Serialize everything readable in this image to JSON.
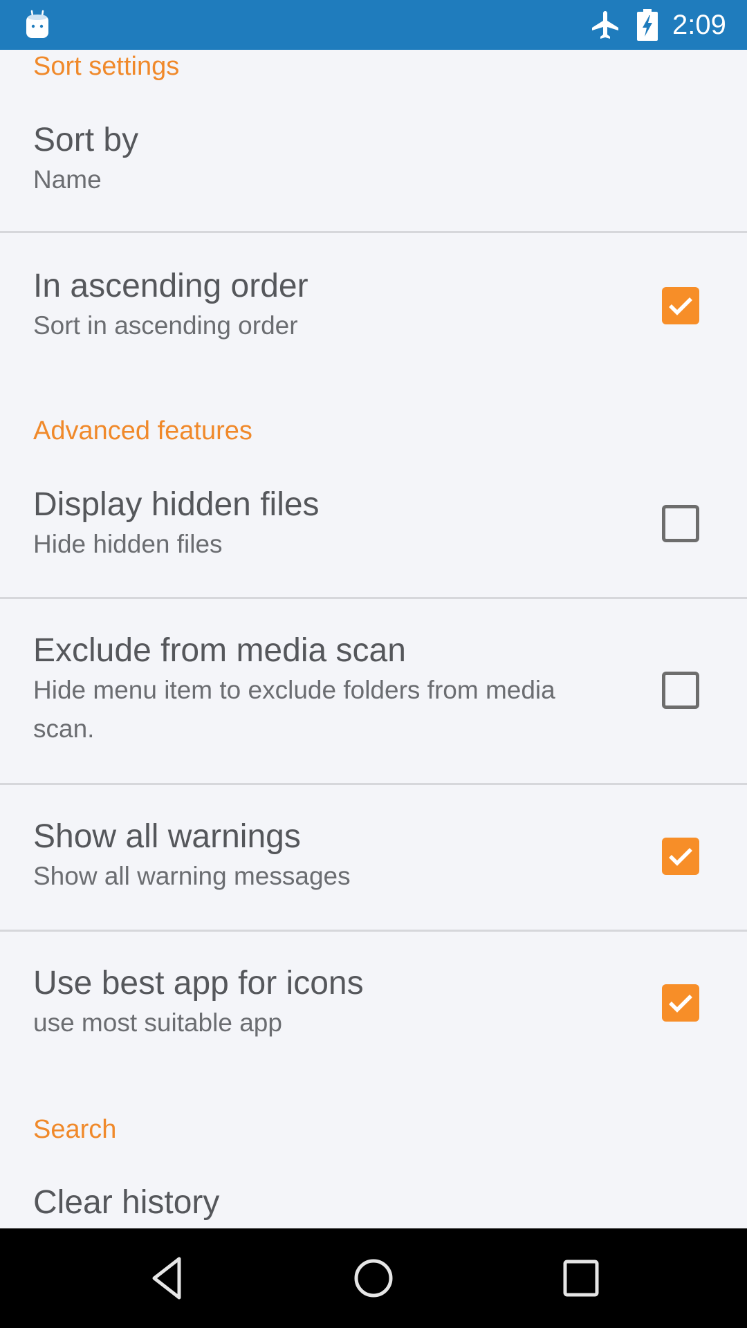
{
  "status_bar": {
    "time": "2:09",
    "icons": [
      "android-app-icon",
      "airplane-mode-icon",
      "battery-charging-icon"
    ],
    "background_color": "#1f7cbd"
  },
  "settings": {
    "accent_color": "#f0892a",
    "sections": [
      {
        "header": "Sort settings",
        "items": [
          {
            "title": "Sort by",
            "summary": "Name",
            "type": "list"
          },
          {
            "title": "In ascending order",
            "summary": "Sort in ascending order",
            "type": "checkbox",
            "checked": true
          }
        ]
      },
      {
        "header": "Advanced features",
        "items": [
          {
            "title": "Display hidden files",
            "summary": "Hide hidden files",
            "type": "checkbox",
            "checked": false
          },
          {
            "title": "Exclude from media scan",
            "summary": "Hide menu item to exclude folders from media scan.",
            "type": "checkbox",
            "checked": false
          },
          {
            "title": "Show all warnings",
            "summary": "Show all warning messages",
            "type": "checkbox",
            "checked": true
          },
          {
            "title": "Use best app for icons",
            "summary": "use most suitable app",
            "type": "checkbox",
            "checked": true
          }
        ]
      },
      {
        "header": "Search",
        "items": [
          {
            "title": "Clear history",
            "type": "action"
          }
        ]
      }
    ]
  },
  "nav_bar": {
    "buttons": [
      "back",
      "home",
      "recents"
    ]
  }
}
